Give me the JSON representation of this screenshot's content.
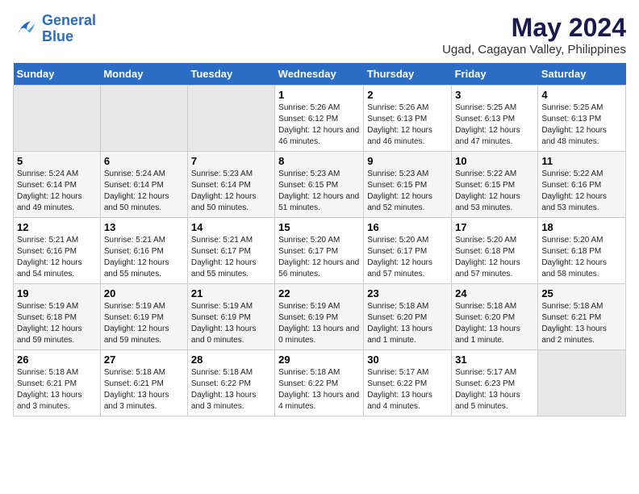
{
  "header": {
    "logo_line1": "General",
    "logo_line2": "Blue",
    "title": "May 2024",
    "subtitle": "Ugad, Cagayan Valley, Philippines"
  },
  "weekdays": [
    "Sunday",
    "Monday",
    "Tuesday",
    "Wednesday",
    "Thursday",
    "Friday",
    "Saturday"
  ],
  "weeks": [
    [
      {
        "day": "",
        "empty": true
      },
      {
        "day": "",
        "empty": true
      },
      {
        "day": "",
        "empty": true
      },
      {
        "day": "1",
        "sunrise": "Sunrise: 5:26 AM",
        "sunset": "Sunset: 6:12 PM",
        "daylight": "Daylight: 12 hours and 46 minutes."
      },
      {
        "day": "2",
        "sunrise": "Sunrise: 5:26 AM",
        "sunset": "Sunset: 6:13 PM",
        "daylight": "Daylight: 12 hours and 46 minutes."
      },
      {
        "day": "3",
        "sunrise": "Sunrise: 5:25 AM",
        "sunset": "Sunset: 6:13 PM",
        "daylight": "Daylight: 12 hours and 47 minutes."
      },
      {
        "day": "4",
        "sunrise": "Sunrise: 5:25 AM",
        "sunset": "Sunset: 6:13 PM",
        "daylight": "Daylight: 12 hours and 48 minutes."
      }
    ],
    [
      {
        "day": "5",
        "sunrise": "Sunrise: 5:24 AM",
        "sunset": "Sunset: 6:14 PM",
        "daylight": "Daylight: 12 hours and 49 minutes."
      },
      {
        "day": "6",
        "sunrise": "Sunrise: 5:24 AM",
        "sunset": "Sunset: 6:14 PM",
        "daylight": "Daylight: 12 hours and 50 minutes."
      },
      {
        "day": "7",
        "sunrise": "Sunrise: 5:23 AM",
        "sunset": "Sunset: 6:14 PM",
        "daylight": "Daylight: 12 hours and 50 minutes."
      },
      {
        "day": "8",
        "sunrise": "Sunrise: 5:23 AM",
        "sunset": "Sunset: 6:15 PM",
        "daylight": "Daylight: 12 hours and 51 minutes."
      },
      {
        "day": "9",
        "sunrise": "Sunrise: 5:23 AM",
        "sunset": "Sunset: 6:15 PM",
        "daylight": "Daylight: 12 hours and 52 minutes."
      },
      {
        "day": "10",
        "sunrise": "Sunrise: 5:22 AM",
        "sunset": "Sunset: 6:15 PM",
        "daylight": "Daylight: 12 hours and 53 minutes."
      },
      {
        "day": "11",
        "sunrise": "Sunrise: 5:22 AM",
        "sunset": "Sunset: 6:16 PM",
        "daylight": "Daylight: 12 hours and 53 minutes."
      }
    ],
    [
      {
        "day": "12",
        "sunrise": "Sunrise: 5:21 AM",
        "sunset": "Sunset: 6:16 PM",
        "daylight": "Daylight: 12 hours and 54 minutes."
      },
      {
        "day": "13",
        "sunrise": "Sunrise: 5:21 AM",
        "sunset": "Sunset: 6:16 PM",
        "daylight": "Daylight: 12 hours and 55 minutes."
      },
      {
        "day": "14",
        "sunrise": "Sunrise: 5:21 AM",
        "sunset": "Sunset: 6:17 PM",
        "daylight": "Daylight: 12 hours and 55 minutes."
      },
      {
        "day": "15",
        "sunrise": "Sunrise: 5:20 AM",
        "sunset": "Sunset: 6:17 PM",
        "daylight": "Daylight: 12 hours and 56 minutes."
      },
      {
        "day": "16",
        "sunrise": "Sunrise: 5:20 AM",
        "sunset": "Sunset: 6:17 PM",
        "daylight": "Daylight: 12 hours and 57 minutes."
      },
      {
        "day": "17",
        "sunrise": "Sunrise: 5:20 AM",
        "sunset": "Sunset: 6:18 PM",
        "daylight": "Daylight: 12 hours and 57 minutes."
      },
      {
        "day": "18",
        "sunrise": "Sunrise: 5:20 AM",
        "sunset": "Sunset: 6:18 PM",
        "daylight": "Daylight: 12 hours and 58 minutes."
      }
    ],
    [
      {
        "day": "19",
        "sunrise": "Sunrise: 5:19 AM",
        "sunset": "Sunset: 6:18 PM",
        "daylight": "Daylight: 12 hours and 59 minutes."
      },
      {
        "day": "20",
        "sunrise": "Sunrise: 5:19 AM",
        "sunset": "Sunset: 6:19 PM",
        "daylight": "Daylight: 12 hours and 59 minutes."
      },
      {
        "day": "21",
        "sunrise": "Sunrise: 5:19 AM",
        "sunset": "Sunset: 6:19 PM",
        "daylight": "Daylight: 13 hours and 0 minutes."
      },
      {
        "day": "22",
        "sunrise": "Sunrise: 5:19 AM",
        "sunset": "Sunset: 6:19 PM",
        "daylight": "Daylight: 13 hours and 0 minutes."
      },
      {
        "day": "23",
        "sunrise": "Sunrise: 5:18 AM",
        "sunset": "Sunset: 6:20 PM",
        "daylight": "Daylight: 13 hours and 1 minute."
      },
      {
        "day": "24",
        "sunrise": "Sunrise: 5:18 AM",
        "sunset": "Sunset: 6:20 PM",
        "daylight": "Daylight: 13 hours and 1 minute."
      },
      {
        "day": "25",
        "sunrise": "Sunrise: 5:18 AM",
        "sunset": "Sunset: 6:21 PM",
        "daylight": "Daylight: 13 hours and 2 minutes."
      }
    ],
    [
      {
        "day": "26",
        "sunrise": "Sunrise: 5:18 AM",
        "sunset": "Sunset: 6:21 PM",
        "daylight": "Daylight: 13 hours and 3 minutes."
      },
      {
        "day": "27",
        "sunrise": "Sunrise: 5:18 AM",
        "sunset": "Sunset: 6:21 PM",
        "daylight": "Daylight: 13 hours and 3 minutes."
      },
      {
        "day": "28",
        "sunrise": "Sunrise: 5:18 AM",
        "sunset": "Sunset: 6:22 PM",
        "daylight": "Daylight: 13 hours and 3 minutes."
      },
      {
        "day": "29",
        "sunrise": "Sunrise: 5:18 AM",
        "sunset": "Sunset: 6:22 PM",
        "daylight": "Daylight: 13 hours and 4 minutes."
      },
      {
        "day": "30",
        "sunrise": "Sunrise: 5:17 AM",
        "sunset": "Sunset: 6:22 PM",
        "daylight": "Daylight: 13 hours and 4 minutes."
      },
      {
        "day": "31",
        "sunrise": "Sunrise: 5:17 AM",
        "sunset": "Sunset: 6:23 PM",
        "daylight": "Daylight: 13 hours and 5 minutes."
      },
      {
        "day": "",
        "empty": true
      }
    ]
  ]
}
